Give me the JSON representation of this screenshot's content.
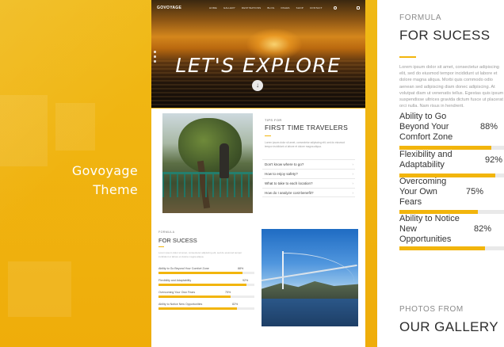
{
  "showcase": {
    "theme_name": "Govoyage Theme"
  },
  "hero": {
    "logo": "GOVOYAGE",
    "menu": [
      "HOME",
      "GALLERY",
      "DESTINATIONS",
      "BLOG",
      "PAGES",
      "SHOP",
      "CONTACT"
    ],
    "title": "LET'S EXPLORE",
    "scroll_icon": "arrow-down-icon"
  },
  "tips": {
    "kicker": "TIPS FOR",
    "title": "FIRST TIME TRAVELERS",
    "text": "Lorem ipsum dolor sit amet, consectetur adipiscing elit, sed do eiusmod tempor incididunt ut labore et dolore magna aliqua.",
    "questions": [
      "Don't know where to go?",
      "How to enjoy safety?",
      "What to take to each location?",
      "How do I analyze cost-benefit?"
    ]
  },
  "sucess_card": {
    "kicker": "FORMULA",
    "title": "FOR SUCESS",
    "text": "Lorem ipsum dolor sit amet, consectetur adipiscing elit, sed do eiusmod tempor incididunt ut labore et dolore magna aliqua.",
    "skills": [
      {
        "label": "Ability to Go Beyond Your Comfort Zone",
        "value": 88,
        "pct": "88%"
      },
      {
        "label": "Flexibility and Adaptability",
        "value": 92,
        "pct": "92%"
      },
      {
        "label": "Overcoming Your Own Fears",
        "value": 75,
        "pct": "75%"
      },
      {
        "label": "Ability to Notice New Opportunities",
        "value": 82,
        "pct": "82%"
      }
    ]
  },
  "panel": {
    "kicker": "FORMULA",
    "title": "FOR SUCESS",
    "text": "Lorem ipsum dolor sit amet, consectetur adipiscing elit, sed do eiusmod tempor incididunt ut labore et dolore magna aliqua. Morbi quis commodo odio aenean sed adipiscing diam donec adipiscing. At volutpat diam ut venenatis tellus. Egestas quis ipsum suspendisse ultrices gravida dictum fusce ut placerat orci nulla. Nam risus in hendrerit.",
    "skills": [
      {
        "label": "Ability to Go Beyond Your Comfort Zone",
        "value": 88,
        "pct": "88%"
      },
      {
        "label": "Flexibility and Adaptability",
        "value": 92,
        "pct": "92%"
      },
      {
        "label": "Overcoming Your Own Fears",
        "value": 75,
        "pct": "75%"
      },
      {
        "label": "Ability to Notice New Opportunities",
        "value": 82,
        "pct": "82%"
      }
    ],
    "gallery_kicker": "PHOTOS FROM",
    "gallery_title": "OUR GALLERY"
  },
  "colors": {
    "accent": "#f2b50c",
    "background": "#f0b915"
  }
}
